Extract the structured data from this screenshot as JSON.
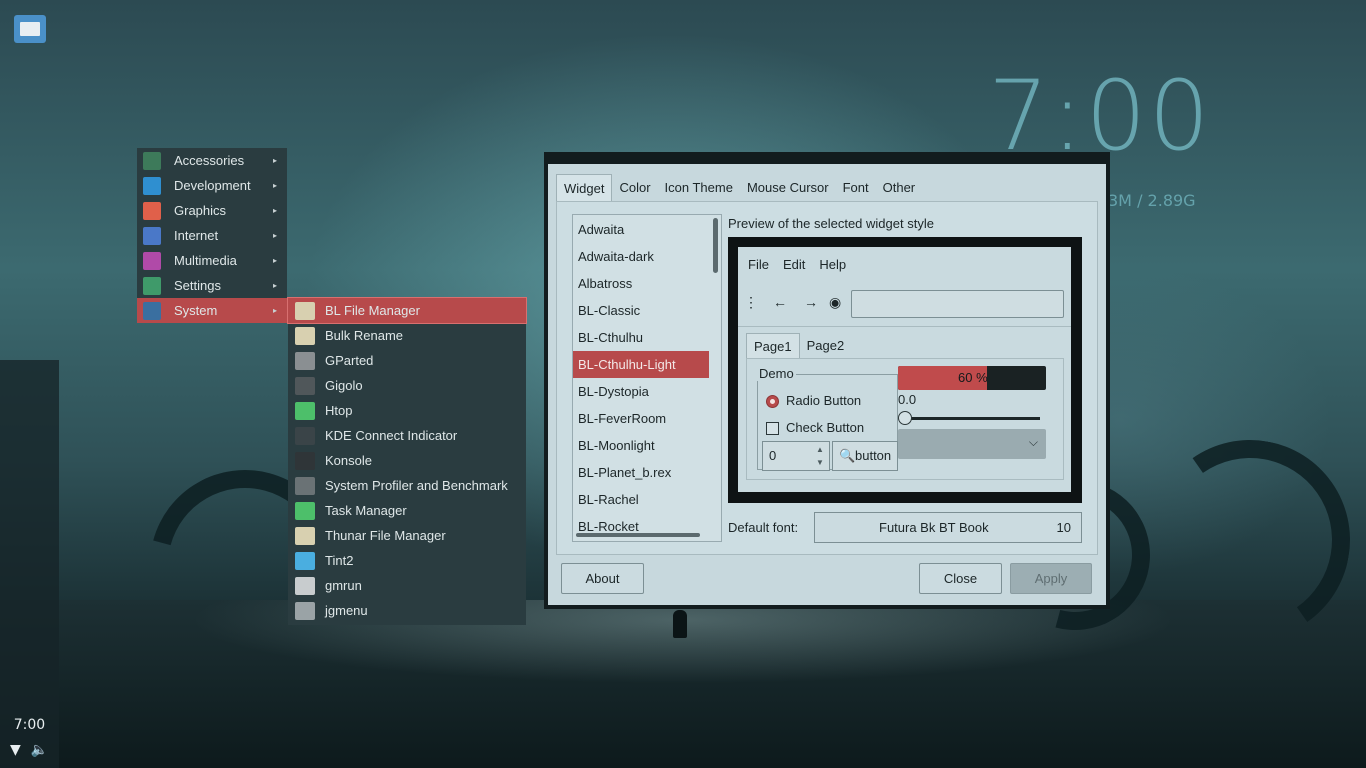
{
  "desktop": {
    "conky_time": "7:00",
    "conky_mem": "3M / 2.89G"
  },
  "panel": {
    "clock": "7:00",
    "icons": [
      "wifi-icon",
      "volume-icon"
    ]
  },
  "menu": {
    "items": [
      {
        "label": "Accessories",
        "icon": "accessories-icon",
        "color": "#3d7a5a"
      },
      {
        "label": "Development",
        "icon": "development-icon",
        "color": "#2f8fd0"
      },
      {
        "label": "Graphics",
        "icon": "graphics-icon",
        "color": "#e0604a"
      },
      {
        "label": "Internet",
        "icon": "internet-icon",
        "color": "#4a78c8"
      },
      {
        "label": "Multimedia",
        "icon": "multimedia-icon",
        "color": "#b04aa8"
      },
      {
        "label": "Settings",
        "icon": "settings-icon",
        "color": "#3f9a6a"
      },
      {
        "label": "System",
        "icon": "system-icon",
        "color": "#3a6fa0"
      }
    ],
    "active_index": 6
  },
  "submenu": {
    "items": [
      {
        "label": "BL File Manager",
        "icon": "file-manager-icon",
        "color": "#d8d0b0"
      },
      {
        "label": "Bulk Rename",
        "icon": "bulk-rename-icon",
        "color": "#d8d0b0"
      },
      {
        "label": "GParted",
        "icon": "gparted-icon",
        "color": "#8a8f92"
      },
      {
        "label": "Gigolo",
        "icon": "gigolo-icon",
        "color": "#50575a"
      },
      {
        "label": "Htop",
        "icon": "htop-icon",
        "color": "#4dbf6a"
      },
      {
        "label": "KDE Connect Indicator",
        "icon": "kde-connect-icon",
        "color": "#3a4448"
      },
      {
        "label": "Konsole",
        "icon": "konsole-icon",
        "color": "#2f3538"
      },
      {
        "label": "System Profiler and Benchmark",
        "icon": "profiler-icon",
        "color": "#6a7275"
      },
      {
        "label": "Task Manager",
        "icon": "task-manager-icon",
        "color": "#4dbf6a"
      },
      {
        "label": "Thunar File Manager",
        "icon": "thunar-icon",
        "color": "#d8d0b0"
      },
      {
        "label": "Tint2",
        "icon": "tint2-icon",
        "color": "#4aaee0"
      },
      {
        "label": "gmrun",
        "icon": "gmrun-icon",
        "color": "#c8ccce"
      },
      {
        "label": "jgmenu",
        "icon": "jgmenu-icon",
        "color": "#9aa3a6"
      }
    ],
    "active_index": 0
  },
  "dialog": {
    "tabs": [
      "Widget",
      "Color",
      "Icon Theme",
      "Mouse Cursor",
      "Font",
      "Other"
    ],
    "active_tab": 0,
    "themes": [
      "Adwaita",
      "Adwaita-dark",
      "Albatross",
      "BL-Classic",
      "BL-Cthulhu",
      "BL-Cthulhu-Light",
      "BL-Dystopia",
      "BL-FeverRoom",
      "BL-Moonlight",
      "BL-Planet_b.rex",
      "BL-Rachel",
      "BL-Rocket"
    ],
    "selected_theme_index": 5,
    "preview_label": "Preview of the selected widget style",
    "preview": {
      "menubar": [
        "File",
        "Edit",
        "Help"
      ],
      "tabs": [
        "Page1",
        "Page2"
      ],
      "demo_label": "Demo",
      "radio_label": "Radio Button",
      "check_label": "Check Button",
      "spin_value": "0",
      "button_label": "button",
      "progress_text": "60 %",
      "progress_fraction": 0.6,
      "scale_value": "0.0"
    },
    "font_label": "Default font:",
    "font_name": "Futura Bk BT Book",
    "font_size": "10",
    "about_label": "About",
    "close_label": "Close",
    "apply_label": "Apply"
  },
  "colors": {
    "accent": "#b74a4b",
    "menu_bg": "#2a3c40",
    "dialog_bg": "#c7d8dd"
  }
}
